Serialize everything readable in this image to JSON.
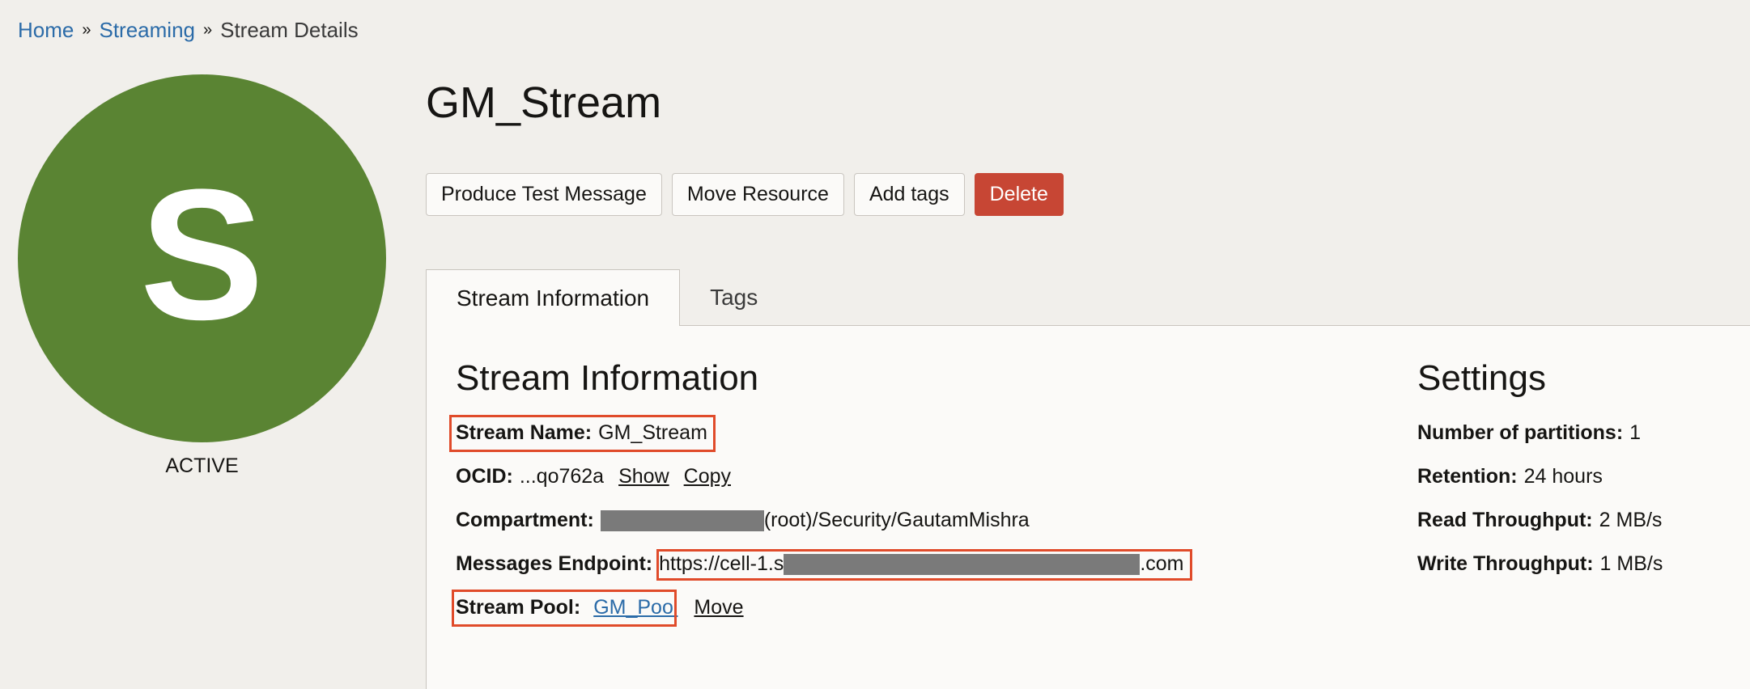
{
  "breadcrumb": {
    "home": "Home",
    "streaming": "Streaming",
    "current": "Stream Details",
    "separator": "»"
  },
  "badge": {
    "letter": "S",
    "color": "#5a8433",
    "status": "ACTIVE"
  },
  "title": "GM_Stream",
  "actions": {
    "produce": "Produce Test Message",
    "move": "Move Resource",
    "add_tags": "Add tags",
    "delete": "Delete"
  },
  "tabs": {
    "info": "Stream Information",
    "tags": "Tags"
  },
  "info": {
    "heading": "Stream Information",
    "stream_name_label": "Stream Name:",
    "stream_name": "GM_Stream",
    "ocid_label": "OCID:",
    "ocid": "...qo762a",
    "show": "Show",
    "copy": "Copy",
    "compartment_label": "Compartment:",
    "compartment_path": "(root)/Security/GautamMishra",
    "endpoint_label": "Messages Endpoint:",
    "endpoint_prefix": "https://cell-1.s",
    "endpoint_suffix": ".com",
    "pool_label": "Stream Pool:",
    "pool": "GM_Pool",
    "move": "Move"
  },
  "settings": {
    "heading": "Settings",
    "partitions_label": "Number of partitions:",
    "partitions": "1",
    "retention_label": "Retention:",
    "retention": "24 hours",
    "read_label": "Read Throughput:",
    "read": "2 MB/s",
    "write_label": "Write Throughput:",
    "write": "1 MB/s"
  },
  "colors": {
    "link": "#2b6ba8",
    "danger": "#c74634",
    "highlight": "#e04b2a"
  }
}
